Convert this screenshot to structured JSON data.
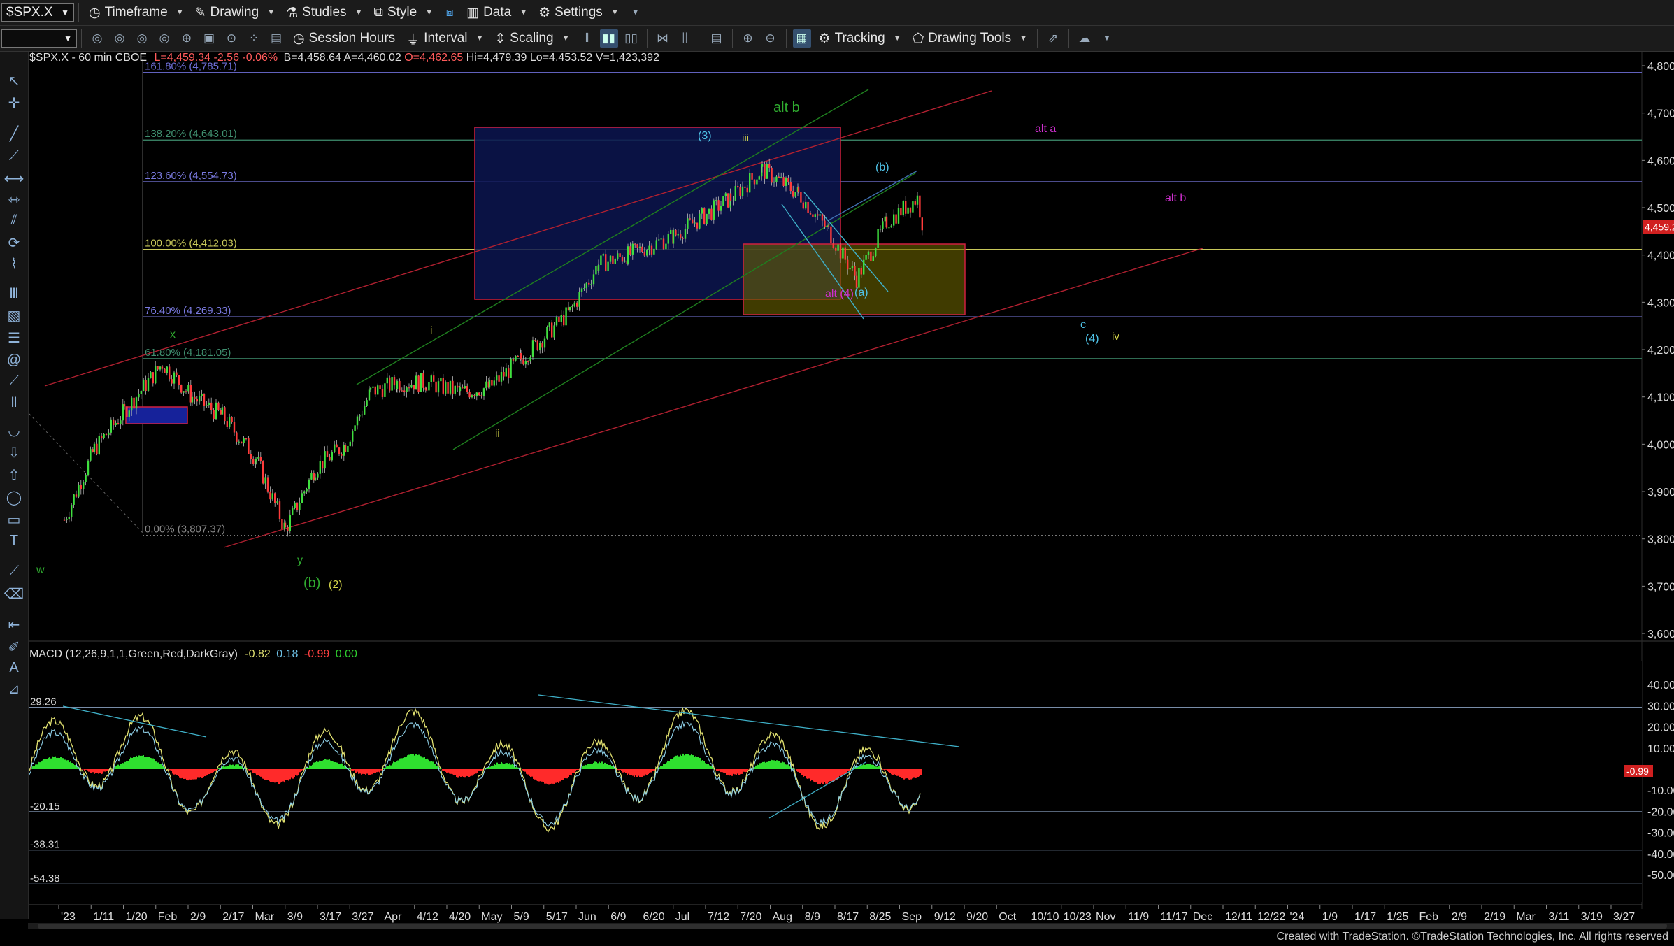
{
  "toolbar_top": {
    "symbol": "$SPX.X",
    "menus": [
      "Timeframe",
      "Drawing",
      "Studies",
      "Style",
      "Data",
      "Settings"
    ]
  },
  "toolbar_bottom": {
    "buttons": [
      "Session Hours",
      "Interval",
      "Scaling",
      "Tracking",
      "Drawing Tools"
    ]
  },
  "chart_header": {
    "symbol_line": "$SPX.X - 60 min  CBOE",
    "last": "L=4,459.34",
    "change": "-2.56",
    "pct": "-0.06%",
    "bid": "B=4,458.64",
    "ask": "A=4,460.02",
    "open": "O=4,462.65",
    "high": "Hi=4,479.39",
    "low": "Lo=4,453.52",
    "volume": "V=1,423,392"
  },
  "price_axis": {
    "ticks": [
      "4,800.00",
      "4,700.00",
      "4,600.00",
      "4,500.00",
      "4,400.00",
      "4,300.00",
      "4,200.00",
      "4,100.00",
      "4,000.00",
      "3,900.00",
      "3,800.00",
      "3,700.00",
      "3,600.00"
    ],
    "values": [
      4800,
      4700,
      4600,
      4500,
      4400,
      4300,
      4200,
      4100,
      4000,
      3900,
      3800,
      3700,
      3600
    ],
    "last_price_tag": "4,459.20",
    "last_price": 4459.2
  },
  "fib_levels": [
    {
      "label": "161.80% (4,785.71)",
      "value": 4785.71,
      "color": "#6f6fd8"
    },
    {
      "label": "138.20% (4,643.01)",
      "value": 4643.01,
      "color": "#3f8f6f"
    },
    {
      "label": "123.60% (4,554.73)",
      "value": 4554.73,
      "color": "#7a7ae0"
    },
    {
      "label": "100.00% (4,412.03)",
      "value": 4412.03,
      "color": "#c8c85a"
    },
    {
      "label": "76.40% (4,269.33)",
      "value": 4269.33,
      "color": "#7a7ae0"
    },
    {
      "label": "61.80% (4,181.05)",
      "value": 4181.05,
      "color": "#3f8f6f"
    },
    {
      "label": "0.00% (3,807.37)",
      "value": 3807.37,
      "color": "#888888"
    }
  ],
  "wave_labels": [
    {
      "text": "alt b",
      "color": "#2faa2f",
      "x": 1106,
      "y": 160,
      "size": 20
    },
    {
      "text": "(3)",
      "color": "#4fc3e8",
      "x": 998,
      "y": 199,
      "size": 16
    },
    {
      "text": "iii",
      "color": "#d8d84a",
      "x": 1061,
      "y": 202,
      "size": 15
    },
    {
      "text": "alt a",
      "color": "#d02fd0",
      "x": 1480,
      "y": 189,
      "size": 16
    },
    {
      "text": "(b)",
      "color": "#4fc3e8",
      "x": 1252,
      "y": 244,
      "size": 16
    },
    {
      "text": "alt b",
      "color": "#d02fd0",
      "x": 1666,
      "y": 288,
      "size": 16
    },
    {
      "text": "alt (4)",
      "color": "#d02fd0",
      "x": 1180,
      "y": 425,
      "size": 16
    },
    {
      "text": "(a)",
      "color": "#4fc3e8",
      "x": 1222,
      "y": 423,
      "size": 16
    },
    {
      "text": "c",
      "color": "#4fc3e8",
      "x": 1545,
      "y": 469,
      "size": 16
    },
    {
      "text": "(4)",
      "color": "#4fc3e8",
      "x": 1552,
      "y": 489,
      "size": 16
    },
    {
      "text": "iv",
      "color": "#d8d84a",
      "x": 1590,
      "y": 486,
      "size": 15
    },
    {
      "text": "i",
      "color": "#d8d84a",
      "x": 615,
      "y": 477,
      "size": 15
    },
    {
      "text": "x",
      "color": "#2faa2f",
      "x": 243,
      "y": 483,
      "size": 16
    },
    {
      "text": "ii",
      "color": "#d8d84a",
      "x": 708,
      "y": 625,
      "size": 15
    },
    {
      "text": "w",
      "color": "#2faa2f",
      "x": 52,
      "y": 820,
      "size": 16
    },
    {
      "text": "y",
      "color": "#2faa2f",
      "x": 425,
      "y": 806,
      "size": 16
    },
    {
      "text": "(b)",
      "color": "#2faa2f",
      "x": 434,
      "y": 840,
      "size": 20
    },
    {
      "text": "(2)",
      "color": "#d8d84a",
      "x": 470,
      "y": 841,
      "size": 16
    }
  ],
  "date_axis": {
    "labels": [
      "'23",
      "1/11",
      "1/20",
      "Feb",
      "2/9",
      "2/17",
      "Mar",
      "3/9",
      "3/17",
      "3/27",
      "Apr",
      "4/12",
      "4/20",
      "May",
      "5/9",
      "5/17",
      "Jun",
      "6/9",
      "6/20",
      "Jul",
      "7/12",
      "7/20",
      "Aug",
      "8/9",
      "8/17",
      "8/25",
      "Sep",
      "9/12",
      "9/20",
      "Oct",
      "10/10",
      "10/23",
      "Nov",
      "11/9",
      "11/17",
      "Dec",
      "12/11",
      "12/22",
      "'24",
      "1/9",
      "1/17",
      "1/25",
      "Feb",
      "2/9",
      "2/19",
      "Mar",
      "3/11",
      "3/19",
      "3/27"
    ]
  },
  "macd": {
    "label": "MACD (12,26,9,1,1,Green,Red,DarkGray)",
    "macd_value": "-0.82",
    "signal_value": "0.18",
    "diff_value": "-0.99",
    "zero_value": "0.00",
    "ticks": [
      "40.00",
      "30.00",
      "20.00",
      "10.00",
      "-10.00",
      "-20.00",
      "-30.00",
      "-40.00",
      "-50.00"
    ],
    "tick_values": [
      40,
      30,
      20,
      10,
      -10,
      -20,
      -30,
      -40,
      -50
    ],
    "level_labels": [
      "29.26",
      "-20.15",
      "-38.31",
      "-54.38"
    ],
    "level_values": [
      29.26,
      -20.15,
      -38.31,
      -54.38
    ],
    "current_tag": "-0.99",
    "current_value": -0.99
  },
  "footer": "Created with TradeStation. ©TradeStation Technologies, Inc. All rights reserved",
  "chart_data": {
    "type": "line",
    "title": "$SPX.X - 60 min",
    "xlabel": "",
    "ylabel": "",
    "ylim": [
      3580,
      4820
    ],
    "x": [
      "'23",
      "1/11",
      "1/20",
      "Feb",
      "2/9",
      "2/17",
      "Mar",
      "3/9",
      "3/17",
      "3/27",
      "Apr",
      "4/12",
      "4/20",
      "May",
      "5/9",
      "5/17",
      "Jun",
      "6/9",
      "6/20",
      "Jul",
      "7/12",
      "7/20",
      "Aug",
      "8/9",
      "8/17",
      "8/25",
      "Sep",
      "9/12"
    ],
    "series": [
      {
        "name": "",
        "values": [
          3840,
          3990,
          4070,
          4170,
          4100,
          4060,
          3970,
          3820,
          3950,
          4000,
          4110,
          4130,
          4130,
          4110,
          4120,
          4180,
          4280,
          4380,
          4400,
          4440,
          4520,
          4580,
          4530,
          4450,
          4350,
          4470,
          4520,
          4460
        ]
      }
    ]
  }
}
